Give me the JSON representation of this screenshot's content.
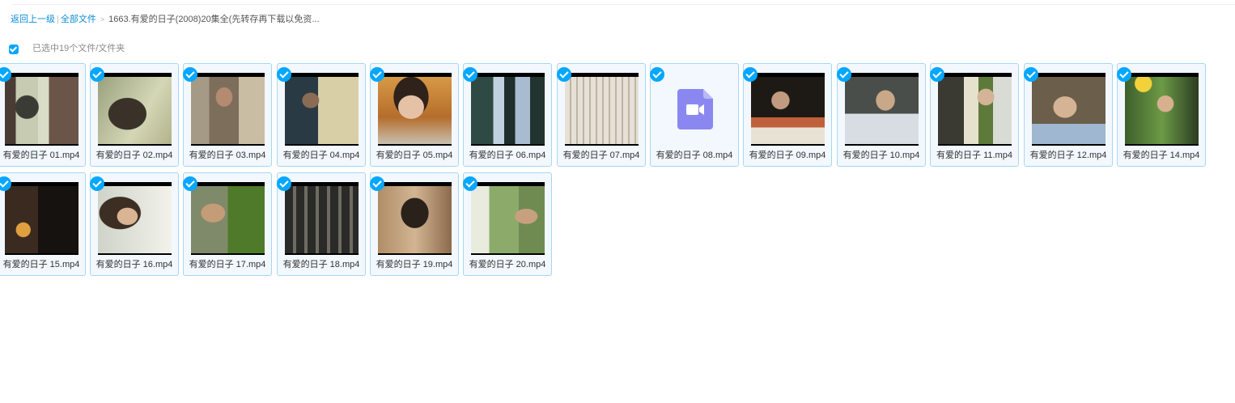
{
  "breadcrumb": {
    "back": "返回上一级",
    "separator": "|",
    "all_files": "全部文件",
    "arrow": ">",
    "current": "1663.有爱的日子(2008)20集全(先转存再下载以免资..."
  },
  "selection": {
    "text": "已选中19个文件/文件夹"
  },
  "colors": {
    "accent": "#06a7ff",
    "link": "#0a8bd6",
    "card_border": "#a8d6f2",
    "card_bg": "#f2f8fe",
    "video_icon": "#8a88f0"
  },
  "files": [
    {
      "name": "有爱的日子 01.mp4",
      "selected": true,
      "thumb": "scene-window-fan"
    },
    {
      "name": "有爱的日子 02.mp4",
      "selected": true,
      "thumb": "scene-woman-hair"
    },
    {
      "name": "有爱的日子 03.mp4",
      "selected": true,
      "thumb": "scene-man-jacket"
    },
    {
      "name": "有爱的日子 04.mp4",
      "selected": true,
      "thumb": "scene-woman-dark"
    },
    {
      "name": "有爱的日子 05.mp4",
      "selected": true,
      "thumb": "scene-woman-face"
    },
    {
      "name": "有爱的日子 06.mp4",
      "selected": true,
      "thumb": "scene-outdoor-couple"
    },
    {
      "name": "有爱的日子 07.mp4",
      "selected": true,
      "thumb": "scene-balcony"
    },
    {
      "name": "有爱的日子 08.mp4",
      "selected": true,
      "thumb": "video-file-icon"
    },
    {
      "name": "有爱的日子 09.mp4",
      "selected": true,
      "thumb": "scene-dinner"
    },
    {
      "name": "有爱的日子 10.mp4",
      "selected": true,
      "thumb": "scene-man-shirt"
    },
    {
      "name": "有爱的日子 11.mp4",
      "selected": true,
      "thumb": "scene-two-people"
    },
    {
      "name": "有爱的日子 12.mp4",
      "selected": true,
      "thumb": "scene-woman-lying"
    },
    {
      "name": "有爱的日子 14.mp4",
      "selected": true,
      "thumb": "scene-woman-drinking"
    },
    {
      "name": "有爱的日子 15.mp4",
      "selected": true,
      "thumb": "scene-night-dark"
    },
    {
      "name": "有爱的日子 16.mp4",
      "selected": true,
      "thumb": "scene-woman-profile"
    },
    {
      "name": "有爱的日子 17.mp4",
      "selected": true,
      "thumb": "scene-man-outdoor"
    },
    {
      "name": "有爱的日子 18.mp4",
      "selected": true,
      "thumb": "scene-corridor"
    },
    {
      "name": "有爱的日子 19.mp4",
      "selected": true,
      "thumb": "scene-woman-back"
    },
    {
      "name": "有爱的日子 20.mp4",
      "selected": true,
      "thumb": "scene-garden"
    }
  ]
}
